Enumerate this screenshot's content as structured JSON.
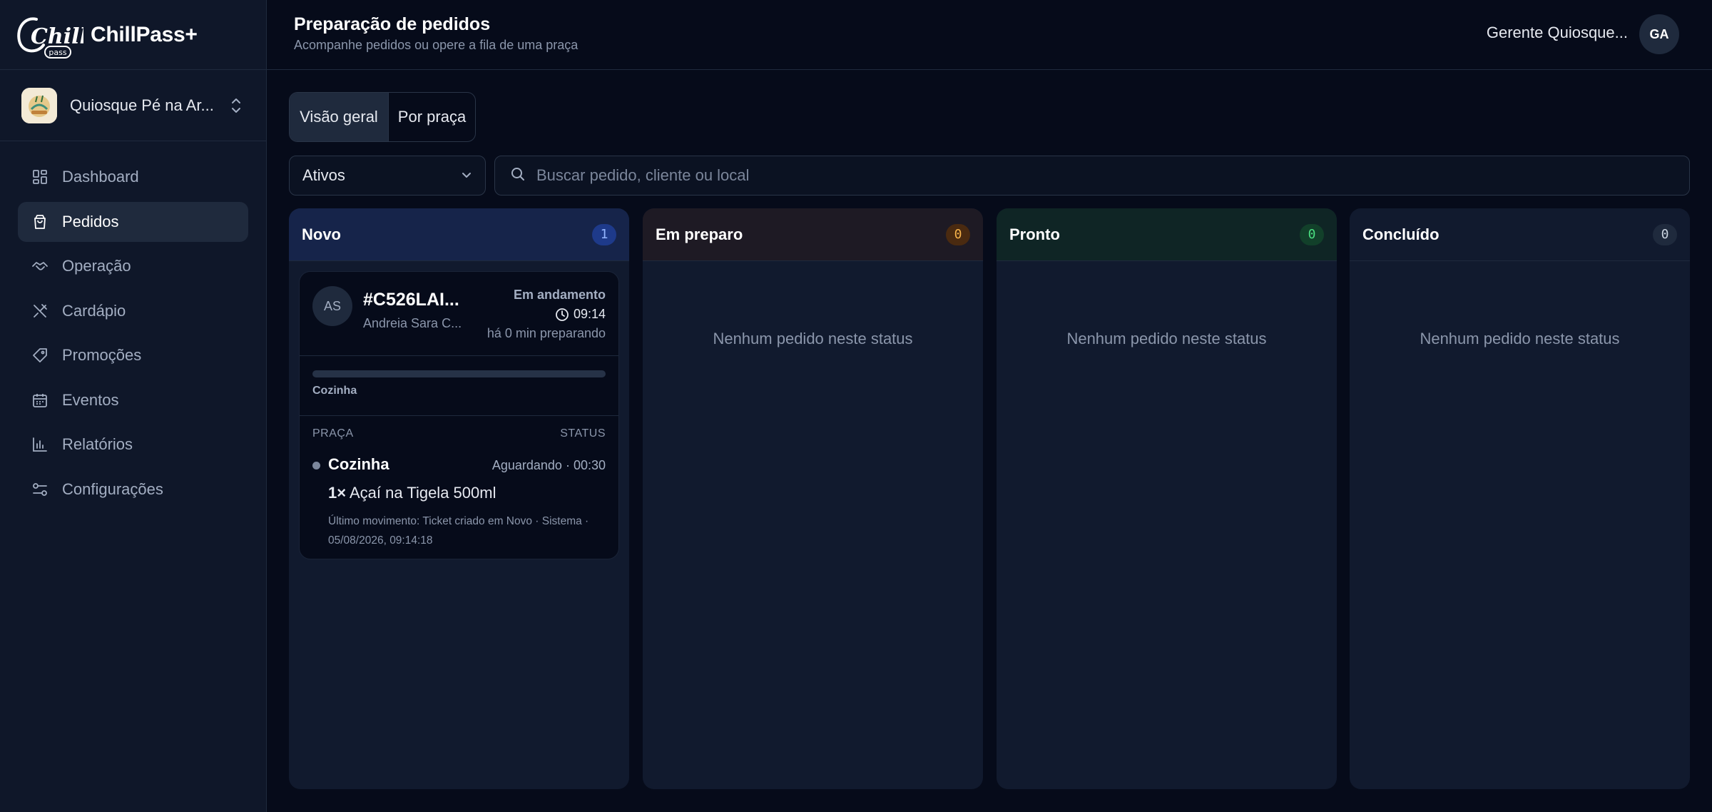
{
  "app": {
    "brand_name": "ChillPass+",
    "logo_text": "Chill",
    "logo_subtext": "pass"
  },
  "sidebar": {
    "store_name": "Quiosque Pé na Ar...",
    "items": [
      {
        "label": "Dashboard",
        "icon": "dashboard-icon",
        "active": false
      },
      {
        "label": "Pedidos",
        "icon": "shopping-bag-icon",
        "active": true
      },
      {
        "label": "Operação",
        "icon": "handshake-icon",
        "active": false
      },
      {
        "label": "Cardápio",
        "icon": "utensils-icon",
        "active": false
      },
      {
        "label": "Promoções",
        "icon": "tag-icon",
        "active": false
      },
      {
        "label": "Eventos",
        "icon": "calendar-icon",
        "active": false
      },
      {
        "label": "Relatórios",
        "icon": "bar-chart-icon",
        "active": false
      },
      {
        "label": "Configurações",
        "icon": "sliders-icon",
        "active": false
      }
    ]
  },
  "header": {
    "title": "Preparação de pedidos",
    "subtitle": "Acompanhe pedidos ou opere a fila de uma praça",
    "user_name": "Gerente Quiosque...",
    "user_initials": "GA"
  },
  "view_toggle": {
    "options": [
      "Visão geral",
      "Por praça"
    ],
    "selected": "Visão geral"
  },
  "filters": {
    "status_value": "Ativos",
    "search_placeholder": "Buscar pedido, cliente ou local"
  },
  "columns": [
    {
      "title": "Novo",
      "count": "1",
      "color": "#3b82f6",
      "empty_text": ""
    },
    {
      "title": "Em preparo",
      "count": "0",
      "color": "#f59e0b",
      "empty_text": "Nenhum pedido neste status"
    },
    {
      "title": "Pronto",
      "count": "0",
      "color": "#22c55e",
      "empty_text": "Nenhum pedido neste status"
    },
    {
      "title": "Concluído",
      "count": "0",
      "color": "#94a3b8",
      "empty_text": "Nenhum pedido neste status"
    }
  ],
  "order": {
    "initials": "AS",
    "id": "#C526LAI...",
    "customer": "Andreia Sara C...",
    "state": "Em andamento",
    "time": "09:14",
    "elapsed": "há 0 min preparando",
    "progress_label": "Cozinha",
    "progress": 0,
    "table_header_station": "PRAÇA",
    "table_header_status": "STATUS",
    "station_name": "Cozinha",
    "station_status": "Aguardando · 00:30",
    "item_qty": "1×",
    "item_name": "Açaí na Tigela 500ml",
    "last_movement": "Último movimento: Ticket criado em Novo · Sistema · 05/08/2026, 09:14:18"
  }
}
